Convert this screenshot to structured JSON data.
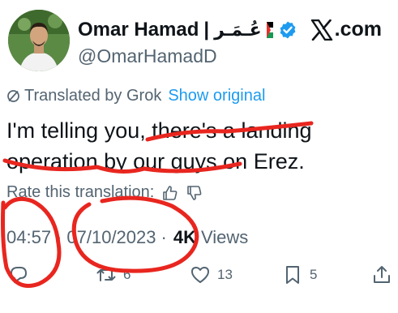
{
  "header": {
    "display_name": "Omar Hamad",
    "name_separator": "|",
    "arabic_name": "عُـمَـر",
    "handle": "@OmarHamadD",
    "brand": ".com"
  },
  "translation": {
    "label": "Translated by Grok",
    "show_original": "Show original"
  },
  "tweet": {
    "text": "I'm telling you, there's a landing operation by our guys on Erez."
  },
  "rate": {
    "label": "Rate this translation:"
  },
  "meta": {
    "time": "04:57",
    "separator": "·",
    "date": "07/10/2023",
    "views_count": "4K",
    "views_label": "Views"
  },
  "actions": {
    "reposts": "6",
    "likes": "13",
    "bookmarks": "5"
  },
  "colors": {
    "accent": "#1d9bf0",
    "annotation": "#e8261f",
    "muted": "#536471"
  }
}
